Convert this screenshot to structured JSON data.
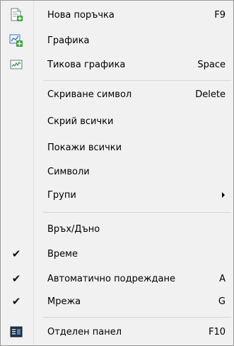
{
  "menu": {
    "items": [
      {
        "label": "Нова поръчка",
        "shortcut": "F9",
        "icon": "new-order-icon"
      },
      {
        "label": "Графика",
        "shortcut": "",
        "icon": "new-chart-icon"
      },
      {
        "label": "Тикова графика",
        "shortcut": "Space",
        "icon": "tick-chart-icon"
      },
      {
        "label": "Скриване символ",
        "shortcut": "Delete"
      },
      {
        "label": "Скрий всички",
        "shortcut": ""
      },
      {
        "label": "Покажи всички",
        "shortcut": ""
      },
      {
        "label": "Символи",
        "shortcut": ""
      },
      {
        "label": "Групи",
        "shortcut": "",
        "submenu": true
      },
      {
        "label": "Връх/Дъно",
        "shortcut": ""
      },
      {
        "label": "Време",
        "shortcut": "",
        "checked": true
      },
      {
        "label": "Автоматично подреждане",
        "shortcut": "A",
        "checked": true
      },
      {
        "label": "Мрежа",
        "shortcut": "G",
        "checked": true
      },
      {
        "label": "Отделен панел",
        "shortcut": "F10",
        "icon": "detached-panel-icon"
      }
    ],
    "check_glyph": "✔"
  }
}
